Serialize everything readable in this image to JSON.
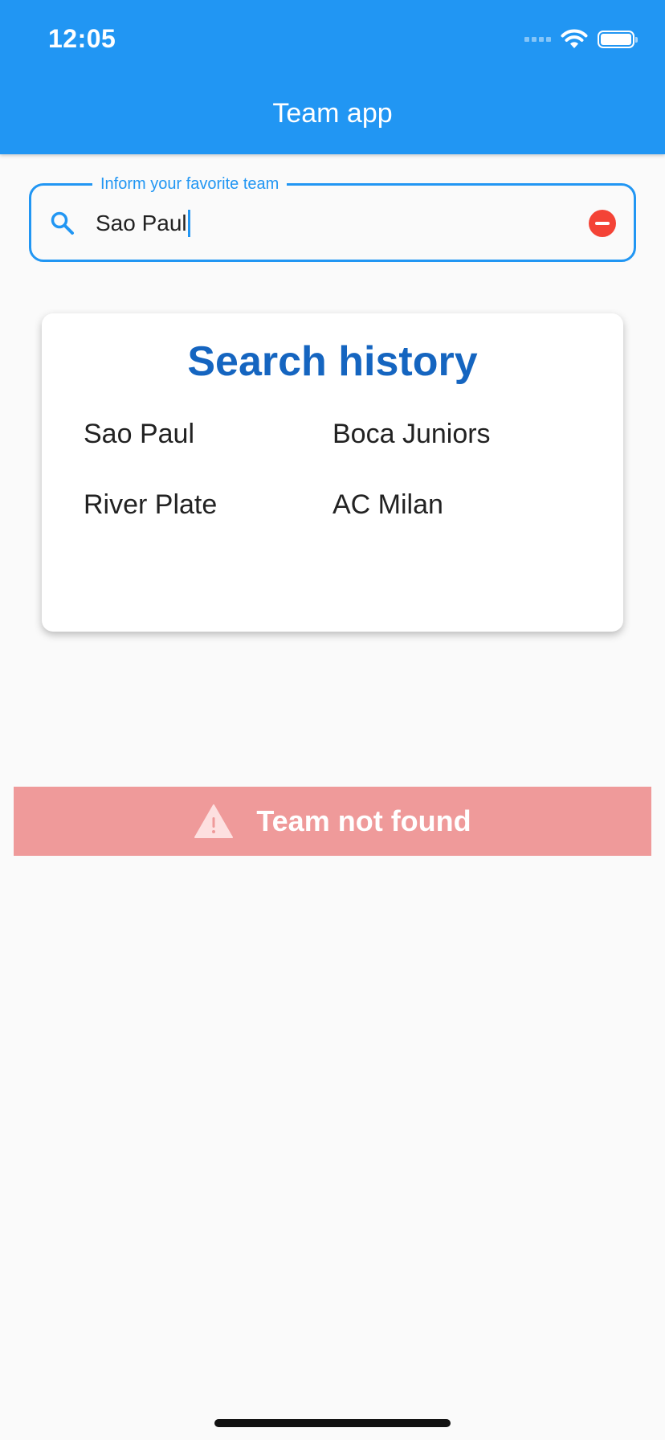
{
  "status_bar": {
    "time": "12:05",
    "signal_icon": "signal-icon",
    "wifi_icon": "wifi-icon",
    "battery_icon": "battery-icon"
  },
  "app_bar": {
    "title": "Team app",
    "color": "#2196f3"
  },
  "search": {
    "label": "Inform your favorite team",
    "value": "Sao Paul",
    "leading_icon": "search-icon",
    "trailing_icon": "clear-icon"
  },
  "history": {
    "title": "Search history",
    "items": [
      {
        "label": "Sao Paul"
      },
      {
        "label": "Boca Juniors"
      },
      {
        "label": "River Plate"
      },
      {
        "label": "AC Milan"
      }
    ]
  },
  "error": {
    "message": "Team not found",
    "icon": "warning-icon",
    "color": "#ef9a9a"
  }
}
